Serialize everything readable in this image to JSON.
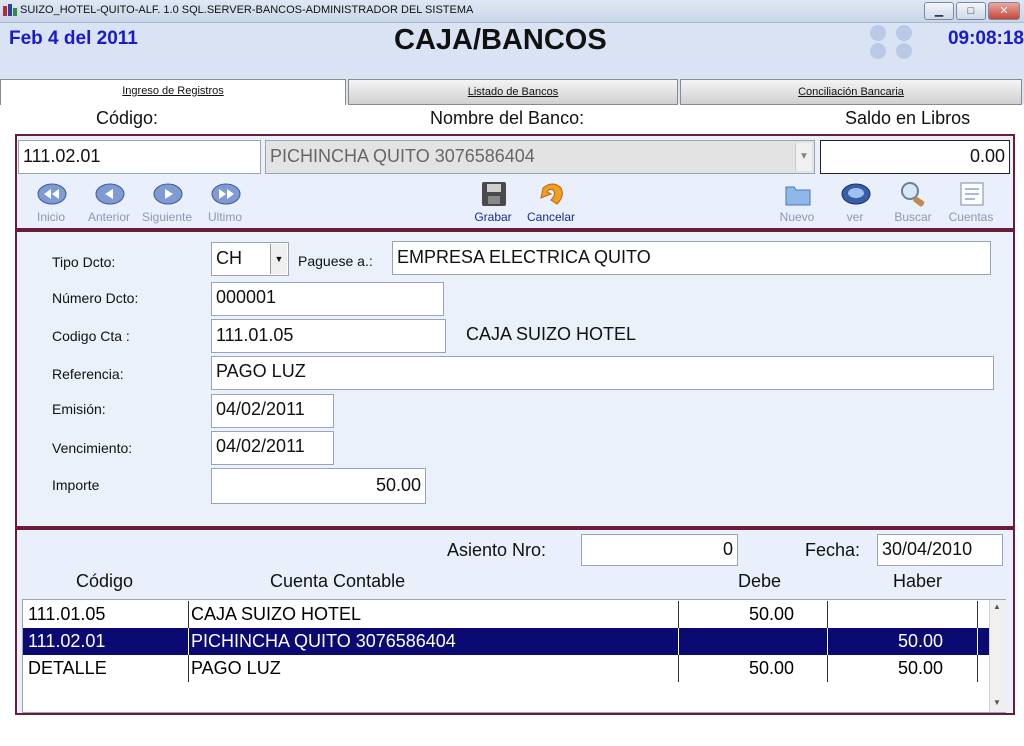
{
  "window": {
    "title": "SUIZO_HOTEL-QUITO-ALF. 1.0 SQL.SERVER-BANCOS-ADMINISTRADOR DEL SISTEMA",
    "minimize": "▁",
    "maximize": "□",
    "close": "✕"
  },
  "header": {
    "date": "Feb 4 del 2011",
    "title": "CAJA/BANCOS",
    "time": "09:08:18"
  },
  "tabs": [
    {
      "label": "Ingreso de Registros"
    },
    {
      "label": "Listado de Bancos"
    },
    {
      "label": "Conciliación Bancaria"
    }
  ],
  "bank": {
    "codigo_label": "Código:",
    "nombre_label": "Nombre del Banco:",
    "saldo_label": "Saldo en Libros",
    "codigo": "111.02.01",
    "nombre": "PICHINCHA QUITO 3076586404",
    "saldo": "0.00"
  },
  "toolbar": {
    "inicio": "Inicio",
    "anterior": "Anterior",
    "siguiente": "Siguiente",
    "ultimo": "Ultimo",
    "grabar": "Grabar",
    "cancelar": "Cancelar",
    "nuevo": "Nuevo",
    "ver": "ver",
    "buscar": "Buscar",
    "cuentas": "Cuentas"
  },
  "doc": {
    "tipo_label": "Tipo Dcto:",
    "tipo": "CH",
    "paguese_label": "Paguese a.:",
    "paguese": "EMPRESA ELECTRICA QUITO",
    "numero_label": "Número Dcto:",
    "numero": "000001",
    "cta_label": "Codigo Cta :",
    "cta": "111.01.05",
    "cta_nombre": "CAJA SUIZO HOTEL",
    "referencia_label": "Referencia:",
    "referencia": "PAGO LUZ",
    "emision_label": "Emisión:",
    "emision": "04/02/2011",
    "vencimiento_label": "Vencimiento:",
    "vencimiento": "04/02/2011",
    "importe_label": "Importe",
    "importe": "50.00"
  },
  "entry": {
    "asiento_label": "Asiento Nro:",
    "asiento": "0",
    "fecha_label": "Fecha:",
    "fecha": "30/04/2010",
    "col_codigo": "Código",
    "col_cuenta": "Cuenta Contable",
    "col_debe": "Debe",
    "col_haber": "Haber",
    "rows": [
      {
        "codigo": "111.01.05",
        "cuenta": "CAJA SUIZO HOTEL",
        "debe": "50.00",
        "haber": ""
      },
      {
        "codigo": "111.02.01",
        "cuenta": "PICHINCHA QUITO 3076586404",
        "debe": "",
        "haber": "50.00"
      },
      {
        "codigo": "DETALLE",
        "cuenta": "PAGO LUZ",
        "debe": "50.00",
        "haber": "50.00"
      }
    ]
  },
  "colors": {
    "accent_blue": "#1a1acc",
    "frame": "#6b1c3b",
    "selection": "#0a0a72"
  }
}
